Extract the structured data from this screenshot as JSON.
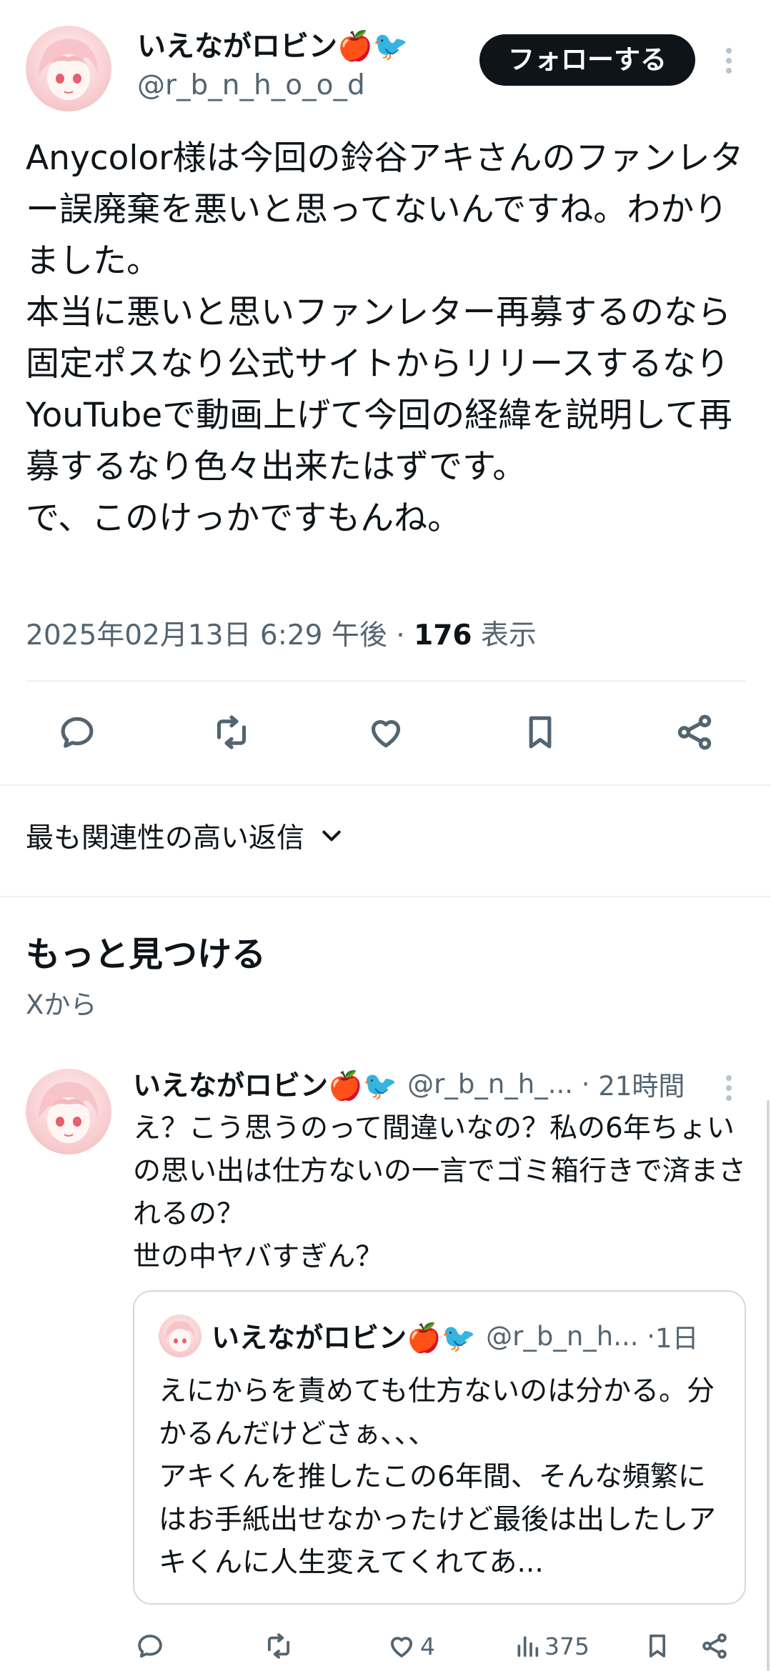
{
  "tweet": {
    "author_name": "いえながロビン🍎🐦",
    "author_handle": "@r_b_n_h_o_o_d",
    "follow_label": "フォローする",
    "text": "Anycolor様は今回の鈴谷アキさんのファンレター誤廃棄を悪いと思ってないんですね。わかりました。\n本当に悪いと思いファンレター再募するのなら固定ポスなり公式サイトからリリースするなりYouTubeで動画上げて今回の経緯を説明して再募するなり色々出来たはずです。\nで、このけっかですもんね。",
    "timestamp": "2025年02月13日 6:29 午後",
    "views_count": "176",
    "views_label": "表示"
  },
  "replies_filter": {
    "label": "最も関連性の高い返信"
  },
  "discover": {
    "title": "もっと見つける",
    "subtitle": "Xから"
  },
  "discover_post": {
    "author_name": "いえながロビン🍎🐦",
    "author_handle": "@r_b_n_h_...",
    "time": "21時間",
    "text": "え？こう思うのって間違いなの？私の6年ちょいの思い出は仕方ないの一言でゴミ箱行きで済まされるの？\n世の中ヤバすぎん？",
    "quote": {
      "author_name": "いえながロビン🍎🐦",
      "author_handle": "@r_b_n_h...",
      "time": "1日",
      "text": "えにからを責めても仕方ないのは分かる。分かるんだけどさぁ、、、\nアキくんを推したこの6年間、そんな頻繁にはお手紙出せなかったけど最後は出したしアキくんに人生変えてくれてあ..."
    },
    "likes": "4",
    "views": "375"
  },
  "icons": {
    "reply": "reply-icon",
    "repost": "repost-icon",
    "like": "heart-icon",
    "bookmark": "bookmark-icon",
    "share": "share-icon",
    "more": "more-icon",
    "chevron": "chevron-down-icon",
    "analytics": "analytics-icon"
  },
  "colors": {
    "text": "#0f1419",
    "muted": "#536471",
    "divider": "#eff3f4",
    "button_bg": "#0f1419"
  }
}
